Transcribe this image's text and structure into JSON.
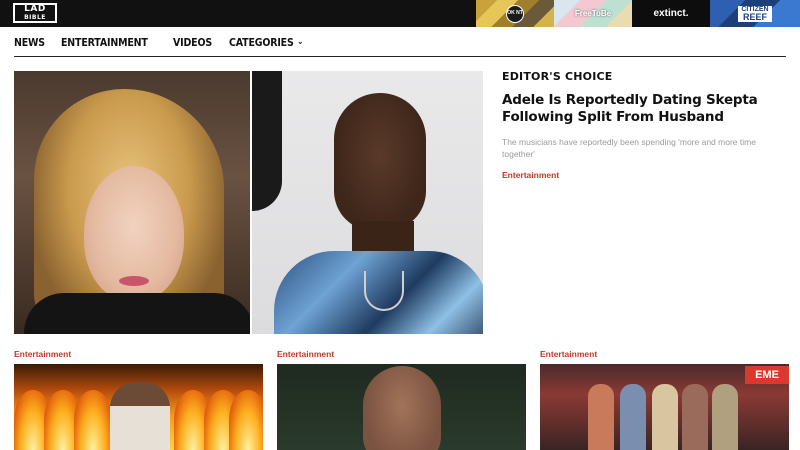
{
  "header": {
    "logo": {
      "line1": "LAD",
      "line2": "BIBLE"
    },
    "brands": [
      {
        "name": "oknt",
        "label": "OK NT"
      },
      {
        "name": "freetobe",
        "label": "FreeToBe"
      },
      {
        "name": "extinct",
        "label": "extinct."
      },
      {
        "name": "citizen-reef",
        "label_top": "CITIZEN",
        "label_bottom": "REEF"
      }
    ]
  },
  "nav": {
    "items": [
      "NEWS",
      "ENTERTAINMENT",
      "VIDEOS"
    ],
    "categories_label": "CATEGORIES"
  },
  "editors_choice": {
    "label": "EDITOR'S CHOICE",
    "title": "Adele Is Reportedly Dating Skepta Following Split From Husband",
    "description": "The musicians have reportedly been spending 'more and more time together'",
    "category": "Entertainment"
  },
  "cards": [
    {
      "category": "Entertainment"
    },
    {
      "category": "Entertainment"
    },
    {
      "category": "Entertainment",
      "sign_text": "EME"
    }
  ],
  "colors": {
    "topbar": "#111111",
    "accent_red": "#c0392b",
    "muted_text": "#9a9a9a"
  }
}
